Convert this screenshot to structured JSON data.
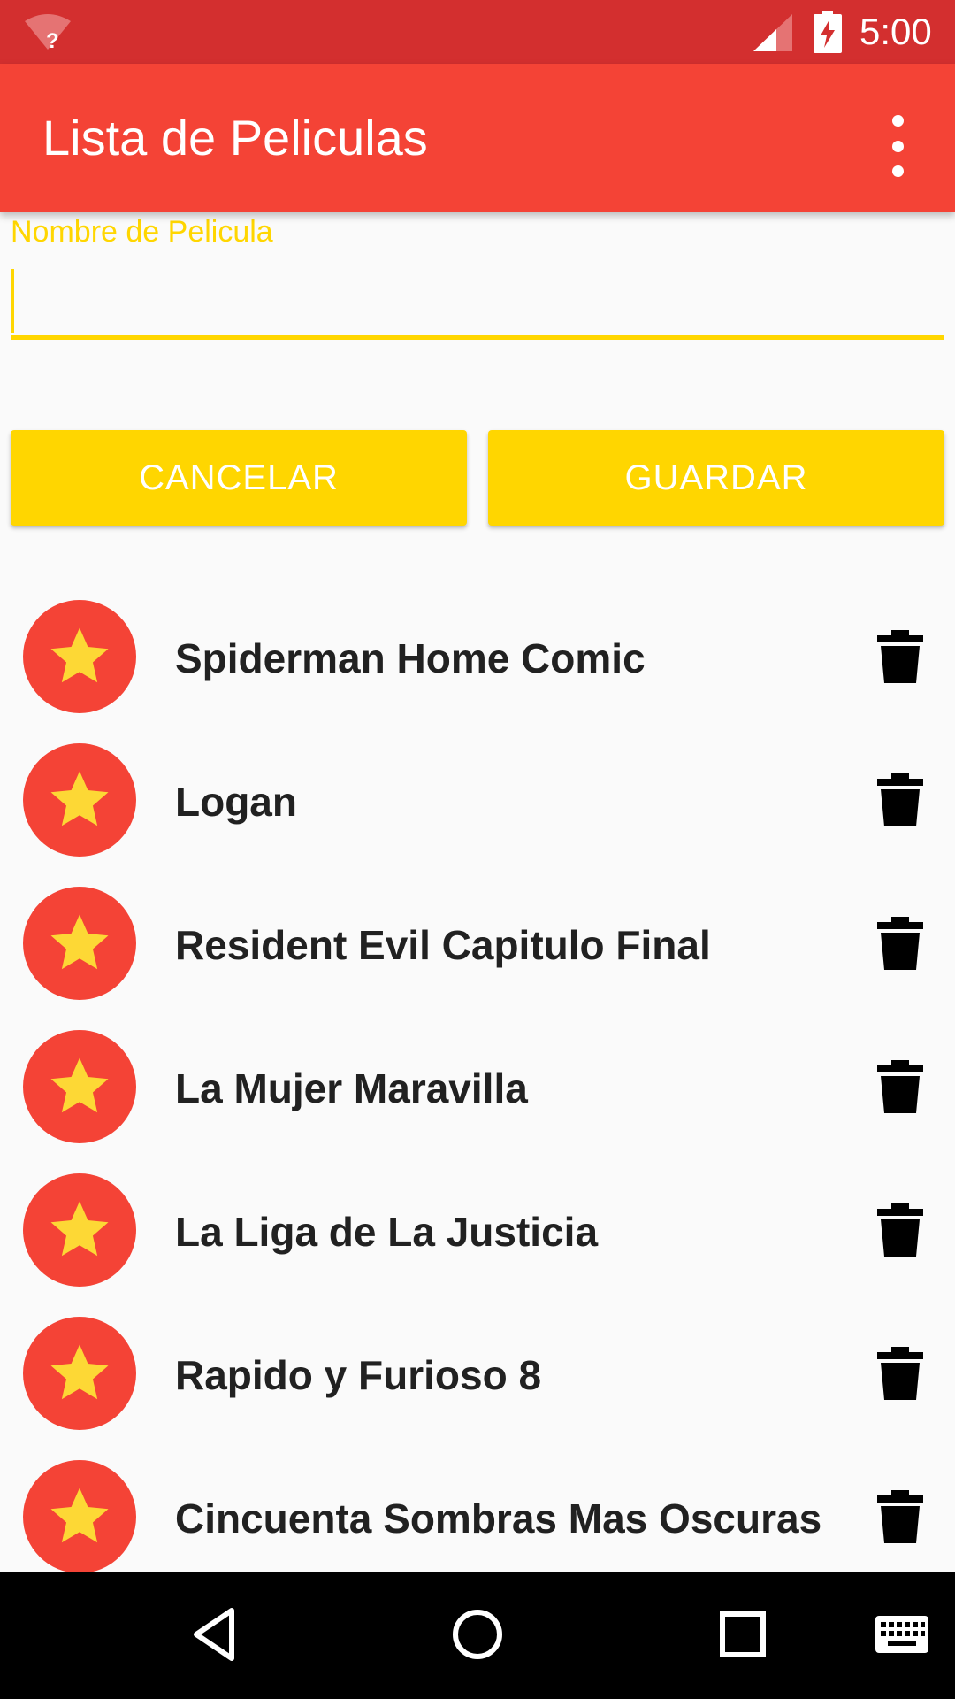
{
  "status_bar": {
    "time": "5:00",
    "icons": [
      "wifi-unknown-icon",
      "cell-signal-icon",
      "battery-charging-icon"
    ]
  },
  "app_bar": {
    "title": "Lista de Peliculas",
    "menu_icon": "more-vert-icon"
  },
  "form": {
    "label": "Nombre de Pelicula",
    "value": "",
    "cancel_label": "CANCELAR",
    "save_label": "GUARDAR"
  },
  "movies": [
    {
      "title": "Spiderman Home Comic"
    },
    {
      "title": "Logan"
    },
    {
      "title": "Resident Evil Capitulo Final"
    },
    {
      "title": "La Mujer Maravilla"
    },
    {
      "title": "La Liga de La Justicia"
    },
    {
      "title": "Rapido y Furioso 8"
    },
    {
      "title": "Cincuenta Sombras Mas Oscuras"
    }
  ],
  "nav_bar": {
    "icons": [
      "back-icon",
      "home-icon",
      "recents-icon",
      "keyboard-icon"
    ]
  },
  "colors": {
    "status_bar": "#D32F2F",
    "app_bar": "#F44336",
    "accent": "#FFD600",
    "star": "#FDD835",
    "text": "#212121"
  }
}
